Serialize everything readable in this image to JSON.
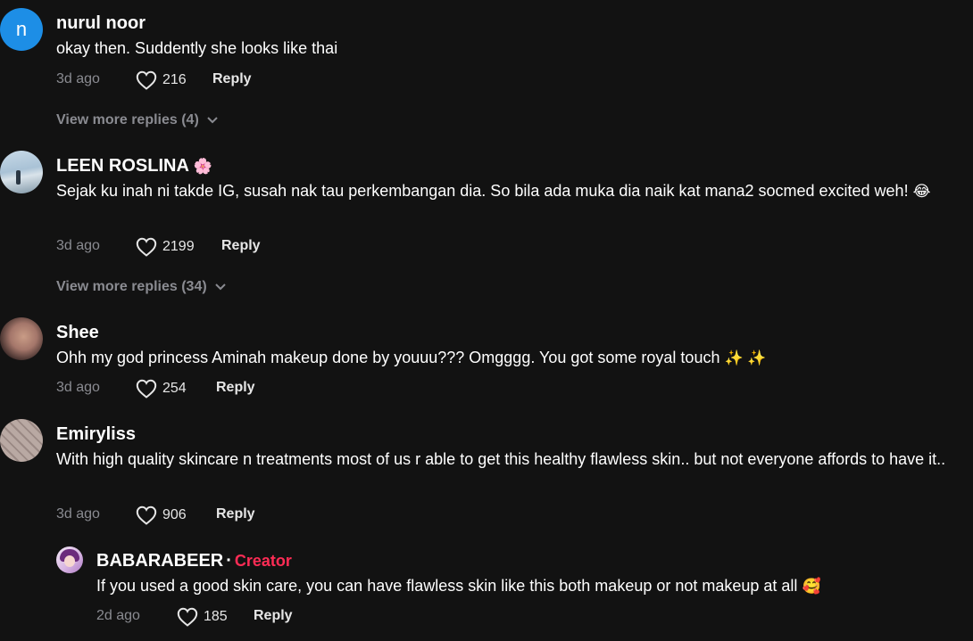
{
  "comments": [
    {
      "avatar_letter": "n",
      "username": "nurul noor",
      "text": "okay then. Suddently she looks like thai",
      "time": "3d ago",
      "likes": "216",
      "reply_label": "Reply",
      "view_more": "View more replies (4)"
    },
    {
      "username": "LEEN ROSLINA",
      "username_emoji": "🌸",
      "text": "Sejak ku inah ni takde IG, susah nak tau perkembangan dia. So bila ada muka dia naik kat mana2 socmed excited weh!",
      "text_emoji": "😂",
      "time": "3d ago",
      "likes": "2199",
      "reply_label": "Reply",
      "view_more": "View more replies (34)"
    },
    {
      "username": "Shee",
      "text": "Ohh my god princess Aminah makeup done by youuu??? Omgggg. You got some royal touch",
      "text_emoji": "✨ ✨",
      "time": "3d ago",
      "likes": "254",
      "reply_label": "Reply"
    },
    {
      "username": "Emiryliss",
      "text": "With high quality skincare n treatments most of us r able to get this healthy flawless skin.. but not everyone affords to have it..",
      "time": "3d ago",
      "likes": "906",
      "reply_label": "Reply"
    }
  ],
  "reply": {
    "username": "BABARABEER",
    "separator": "·",
    "badge": "Creator",
    "text": "If you used a good skin care, you can have flawless skin like this both makeup or not makeup at all",
    "text_emoji": "🥰",
    "time": "2d ago",
    "likes": "185",
    "reply_label": "Reply"
  },
  "icons": {
    "like": "heart-outline-icon",
    "expand": "chevron-down-icon"
  },
  "colors": {
    "background": "#121212",
    "creator_badge": "#fe2c55",
    "meta": "#8a8b91"
  }
}
